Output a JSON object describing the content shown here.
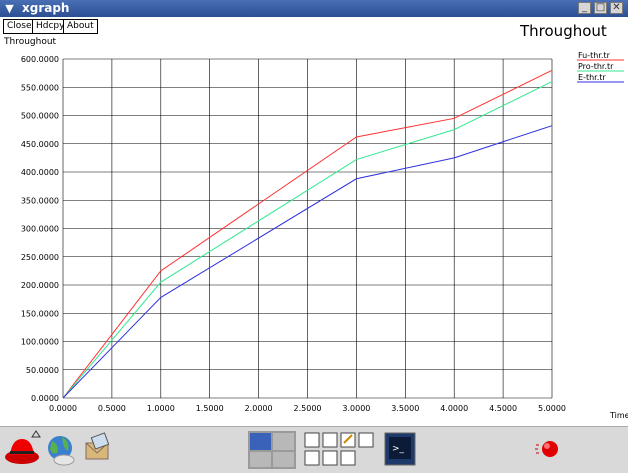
{
  "window": {
    "title": "xgraph"
  },
  "toolbar": {
    "close_label": "Close",
    "hdcpy_label": "Hdcpy",
    "about_label": "About"
  },
  "graph": {
    "title": "Throughout",
    "y_axis_label": "Throughout",
    "x_axis_label": "Time"
  },
  "chart_data": {
    "type": "line",
    "title": "Throughout",
    "xlabel": "Time",
    "ylabel": "Throughout",
    "x": [
      0,
      1,
      3,
      4,
      5
    ],
    "xlim": [
      0,
      5
    ],
    "ylim": [
      0,
      600
    ],
    "x_ticks": [
      "0.0000",
      "0.5000",
      "1.0000",
      "1.5000",
      "2.0000",
      "2.5000",
      "3.0000",
      "3.5000",
      "4.0000",
      "4.5000",
      "5.0000"
    ],
    "y_ticks": [
      "0.0000",
      "50.0000",
      "100.0000",
      "150.0000",
      "200.0000",
      "250.0000",
      "300.0000",
      "350.0000",
      "400.0000",
      "450.0000",
      "500.0000",
      "550.0000",
      "600.0000"
    ],
    "grid": true,
    "legend_position": "top-right",
    "series": [
      {
        "name": "Fu-thr.tr",
        "color": "#ff3030",
        "values": [
          0,
          225,
          462,
          495,
          580
        ]
      },
      {
        "name": "Pro-thr.tr",
        "color": "#30e890",
        "values": [
          0,
          205,
          422,
          475,
          560
        ]
      },
      {
        "name": "E-thr.tr",
        "color": "#3030e0",
        "values": [
          0,
          178,
          388,
          425,
          482
        ]
      }
    ]
  },
  "taskbar": {
    "icons": [
      "redhat-icon",
      "browser-icon",
      "mail-icon",
      "desktop-switcher-icon",
      "document-icons",
      "terminal-icon",
      "alert-icon"
    ]
  },
  "colors": {
    "titlebar": "#2c4f92",
    "taskbar": "#d9d9d9",
    "grid": "#000000"
  }
}
